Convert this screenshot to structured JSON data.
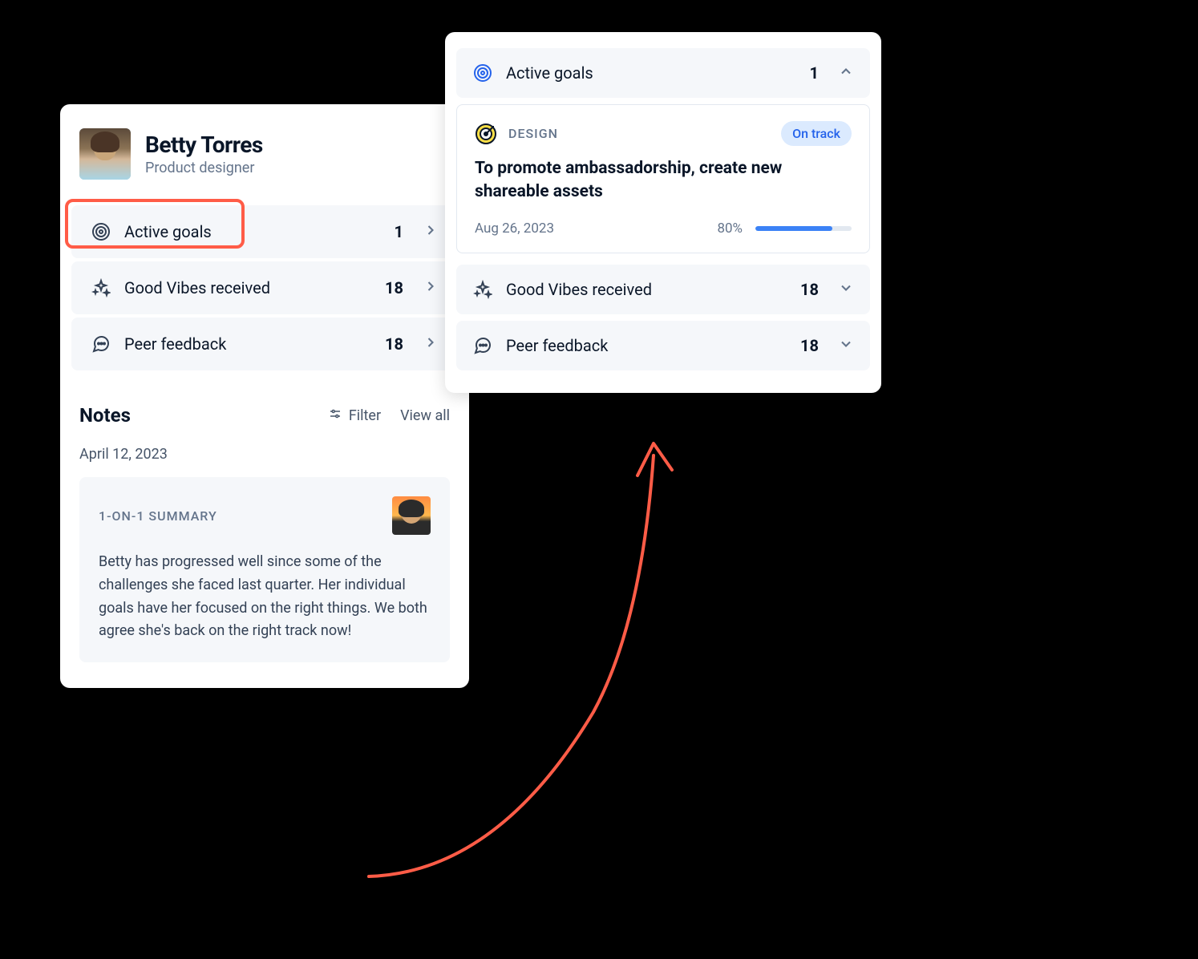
{
  "profile": {
    "name": "Betty Torres",
    "role": "Product designer"
  },
  "stats": {
    "active_goals": {
      "label": "Active goals",
      "value": "1"
    },
    "good_vibes": {
      "label": "Good Vibes received",
      "value": "18"
    },
    "peer_feedback": {
      "label": "Peer feedback",
      "value": "18"
    }
  },
  "notes": {
    "title": "Notes",
    "filter_label": "Filter",
    "view_all_label": "View all",
    "date": "April 12, 2023",
    "summary_label": "1-ON-1 SUMMARY",
    "summary_text": "Betty has progressed well since some of the challenges she faced last quarter. Her individual goals have her focused on the right things. We both agree she's back on the right track now!"
  },
  "expanded": {
    "active_goals": {
      "label": "Active goals",
      "value": "1"
    },
    "good_vibes": {
      "label": "Good Vibes received",
      "value": "18"
    },
    "peer_feedback": {
      "label": "Peer feedback",
      "value": "18"
    }
  },
  "goal": {
    "category": "DESIGN",
    "status": "On track",
    "title": "To promote ambassadorship, create new shareable assets",
    "date": "Aug 26, 2023",
    "percent_label": "80%",
    "percent_value": 80
  }
}
